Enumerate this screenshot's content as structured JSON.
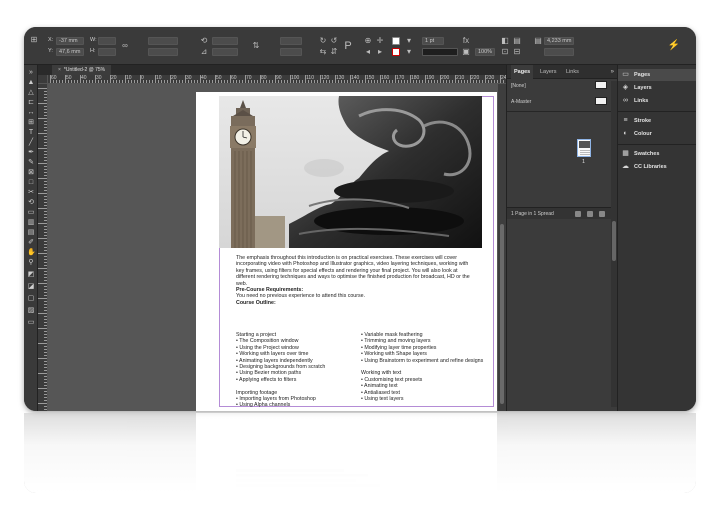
{
  "control_bar": {
    "x_label": "X:",
    "x_value": "-37 mm",
    "y_label": "Y:",
    "y_value": "47,6 mm",
    "w_label": "W:",
    "h_label": "H:",
    "stroke_weight": "1 pt",
    "zoom": "100%",
    "offset_value": "4,233 mm"
  },
  "document_tab": {
    "title": "*Untitled-2 @ 75%",
    "close_glyph": "×"
  },
  "ruler": {
    "h_labels": [
      "60",
      "50",
      "40",
      "30",
      "20",
      "10",
      "0",
      "10",
      "20",
      "30",
      "40",
      "50",
      "60",
      "70",
      "80",
      "90",
      "100",
      "110",
      "120",
      "130",
      "140",
      "150",
      "160",
      "170",
      "180",
      "190",
      "200",
      "210",
      "220",
      "230",
      "240"
    ]
  },
  "document": {
    "intro": "The emphasis throughout this introduction is on practical exercises. These exercises will cover incorporating video with Photoshop and Illustrator graphics, video layering techniques, working with key frames, using filters for special effects and rendering your final project. You will also look at different rendering techniques and ways to optimise the finished production for broadcast, HD or the web.",
    "prereq_heading": "Pre-Course Requirements:",
    "prereq_text": "You need no previous experience to attend this course.",
    "outline_heading": "Course Outline:",
    "left_col": [
      "Starting a project",
      "• The Composition window",
      "• Using the Project window",
      "• Working with layers over time",
      "• Animating layers independently",
      "• Designing backgrounds from scratch",
      "• Using Bezier motion paths",
      "• Applying effects to filters",
      "",
      "Importing footage",
      "• Importing layers from Photoshop",
      "• Using Alpha channels"
    ],
    "right_col": [
      "• Variable mask feathering",
      "• Trimming and moving layers",
      "• Modifying layer time properties",
      "• Working with Shape layers",
      "• Using Brainstorm to experiment and refine designs",
      "",
      "Working with text",
      "• Customising text presets",
      "• Animating text",
      "• Antialiased text",
      "• Using text layers"
    ]
  },
  "pages_panel": {
    "tabs": [
      "Pages",
      "Layers",
      "Links"
    ],
    "menu_glyph": "»",
    "none_label": "[None]",
    "master_label": "A-Master",
    "page_number": "1",
    "footer_text": "1 Page in 1 Spread"
  },
  "dock": {
    "items": [
      {
        "label": "Pages",
        "icon": "pages-icon",
        "glyph": "▭"
      },
      {
        "label": "Layers",
        "icon": "layers-icon",
        "glyph": "◈"
      },
      {
        "label": "Links",
        "icon": "links-icon",
        "glyph": "∞"
      },
      {
        "label": "Stroke",
        "icon": "stroke-icon",
        "glyph": "≡"
      },
      {
        "label": "Colour",
        "icon": "colour-icon",
        "glyph": "◐"
      },
      {
        "label": "Swatches",
        "icon": "swatches-icon",
        "glyph": "▦"
      },
      {
        "label": "CC Libraries",
        "icon": "cc-libraries-icon",
        "glyph": "☁"
      }
    ]
  },
  "colors": {
    "app_bg": "#2d2d2d",
    "panel_bg": "#3b3b3b",
    "pasteboard": "#565656",
    "margin_guide": "#b48cd6",
    "selection_blue": "#8fb4e6"
  }
}
